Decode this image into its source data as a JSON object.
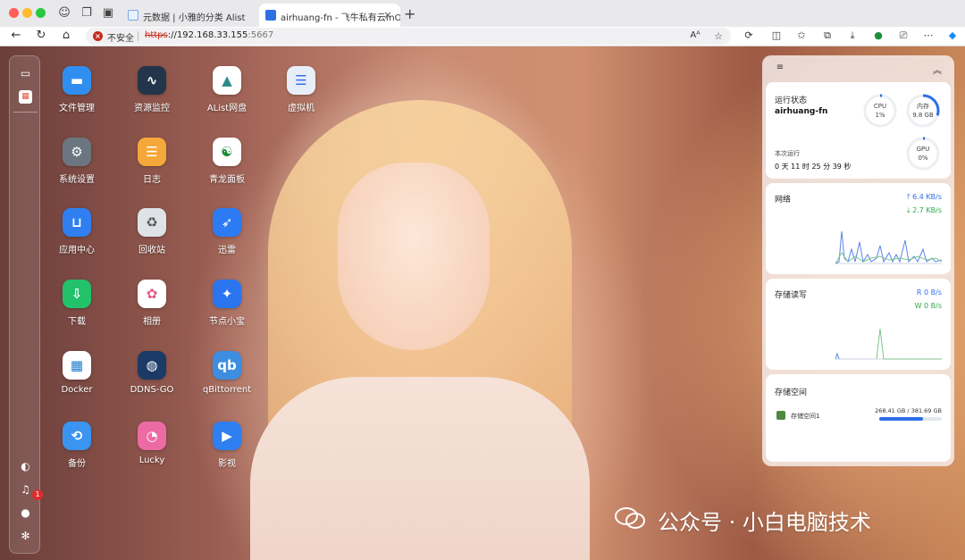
{
  "browser": {
    "tabs": [
      {
        "label": "元数据 | 小雅的分类 Alist",
        "active": false
      },
      {
        "label": "airhuang-fn - 飞牛私有云fnOS",
        "active": true
      }
    ],
    "address": {
      "insecure_label": "不安全",
      "scheme": "https",
      "host": "://192.168.33.155",
      "port": ":5667"
    }
  },
  "desktop": {
    "apps": [
      {
        "label": "文件管理",
        "icon": "folder-icon",
        "color": "#2f8ef0"
      },
      {
        "label": "资源监控",
        "icon": "monitor-chart-icon",
        "color": "#22354a"
      },
      {
        "label": "AList网盘",
        "icon": "alist-icon",
        "color": "#ffffff"
      },
      {
        "label": "虚拟机",
        "icon": "server-icon",
        "color": "#e8eef8"
      },
      {
        "label": "系统设置",
        "icon": "gear-icon",
        "color": "#6b7680"
      },
      {
        "label": "日志",
        "icon": "log-icon",
        "color": "#f5a83a"
      },
      {
        "label": "青龙面板",
        "icon": "qinglong-icon",
        "color": "#ffffff"
      },
      {
        "label": "应用中心",
        "icon": "store-icon",
        "color": "#2f7ff0"
      },
      {
        "label": "回收站",
        "icon": "recycle-icon",
        "color": "#dfe3e8"
      },
      {
        "label": "迅雷",
        "icon": "bird-icon",
        "color": "#2d7bf4"
      },
      {
        "label": "下载",
        "icon": "download-icon",
        "color": "#22c26b"
      },
      {
        "label": "相册",
        "icon": "photos-icon",
        "color": "#ffffff"
      },
      {
        "label": "节点小宝",
        "icon": "node-icon",
        "color": "#2b74f0"
      },
      {
        "label": "Docker",
        "icon": "docker-icon",
        "color": "#ffffff"
      },
      {
        "label": "DDNS-GO",
        "icon": "globe-icon",
        "color": "#1c3a66"
      },
      {
        "label": "qBittorrent",
        "icon": "qb-icon",
        "color": "#3d8ee0"
      },
      {
        "label": "备份",
        "icon": "backup-icon",
        "color": "#3a94f0"
      },
      {
        "label": "Lucky",
        "icon": "lucky-icon",
        "color": "#ec6ba4"
      },
      {
        "label": "影视",
        "icon": "film-icon",
        "color": "#2f7ff0"
      }
    ],
    "notification_count": "1",
    "watermark": "公众号 · 小白电脑技术"
  },
  "widgets": {
    "status": {
      "title": "运行状态",
      "hostname": "airhuang-fn",
      "uptime_label": "本次运行",
      "uptime": "0 天 11 时 25 分 39 秒",
      "cpu": {
        "label": "CPU",
        "value": "1%",
        "fraction": 0.01
      },
      "mem": {
        "label": "内存",
        "value": "9.8 GB",
        "fraction": 0.3
      },
      "gpu": {
        "label": "GPU",
        "value": "0%",
        "fraction": 0.0
      }
    },
    "network": {
      "title": "网络",
      "up": "6.4 KB/s",
      "down": "2.7 KB/s"
    },
    "disk_io": {
      "title": "存储读写",
      "read": "R  0 B/s",
      "write": "W  0 B/s"
    },
    "storage": {
      "title": "存储空间",
      "volume": "存储空间1",
      "usage": "268.41 GB / 381.69 GB",
      "fraction": 0.703
    }
  },
  "colors": {
    "accent": "#2f6fe6",
    "upload": "#2f6fe6",
    "download": "#2fa84f",
    "danger": "#c42b1c"
  }
}
